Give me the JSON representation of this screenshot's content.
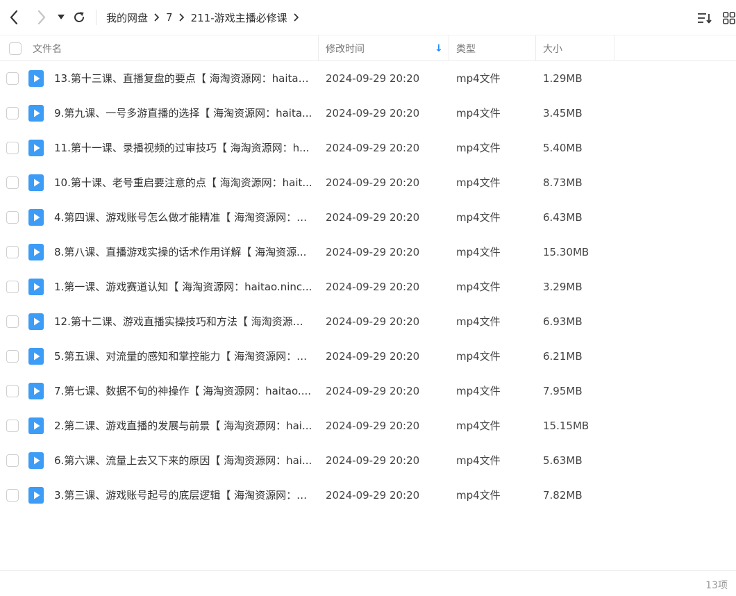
{
  "nav": {
    "icons": [
      "chevron-left-icon",
      "chevron-right-icon",
      "caret-down-icon",
      "refresh-icon"
    ]
  },
  "breadcrumb": {
    "items": [
      "我的网盘",
      "7",
      "211-游戏主播必修课"
    ]
  },
  "toolbar": {
    "icons": [
      "sort-icon",
      "grid-view-icon"
    ]
  },
  "table": {
    "columns": {
      "name": "文件名",
      "modified": "修改时间",
      "type": "类型",
      "size": "大小"
    },
    "sort_indicator": "↓",
    "rows": [
      {
        "name": "13.第十三课、直播复盘的要点【 海淘资源网：haitao....",
        "modified": "2024-09-29 20:20",
        "type": "mp4文件",
        "size": "1.29MB"
      },
      {
        "name": "9.第九课、一号多游直播的选择【 海淘资源网：haita...",
        "modified": "2024-09-29 20:20",
        "type": "mp4文件",
        "size": "3.45MB"
      },
      {
        "name": "11.第十一课、录播视频的过审技巧【 海淘资源网：h...",
        "modified": "2024-09-29 20:20",
        "type": "mp4文件",
        "size": "5.40MB"
      },
      {
        "name": "10.第十课、老号重启要注意的点【 海淘资源网：hait...",
        "modified": "2024-09-29 20:20",
        "type": "mp4文件",
        "size": "8.73MB"
      },
      {
        "name": "4.第四课、游戏账号怎么做才能精准【 海淘资源网：h...",
        "modified": "2024-09-29 20:20",
        "type": "mp4文件",
        "size": "6.43MB"
      },
      {
        "name": "8.第八课、直播游戏实操的话术作用详解【 海淘资源...",
        "modified": "2024-09-29 20:20",
        "type": "mp4文件",
        "size": "15.30MB"
      },
      {
        "name": "1.第一课、游戏赛道认知【 海淘资源网：haitao.ninc...",
        "modified": "2024-09-29 20:20",
        "type": "mp4文件",
        "size": "3.29MB"
      },
      {
        "name": "12.第十二课、游戏直播实操技巧和方法【 海淘资源网...",
        "modified": "2024-09-29 20:20",
        "type": "mp4文件",
        "size": "6.93MB"
      },
      {
        "name": "5.第五课、对流量的感知和掌控能力【 海淘资源网：h...",
        "modified": "2024-09-29 20:20",
        "type": "mp4文件",
        "size": "6.21MB"
      },
      {
        "name": "7.第七课、数据不旬的神操作【 海淘资源网：haitao....",
        "modified": "2024-09-29 20:20",
        "type": "mp4文件",
        "size": "7.95MB"
      },
      {
        "name": "2.第二课、游戏直播的发展与前景【 海淘资源网：hai...",
        "modified": "2024-09-29 20:20",
        "type": "mp4文件",
        "size": "15.15MB"
      },
      {
        "name": "6.第六课、流量上去又下来的原因【 海淘资源网：hai...",
        "modified": "2024-09-29 20:20",
        "type": "mp4文件",
        "size": "5.63MB"
      },
      {
        "name": "3.第三课、游戏账号起号的底层逻辑【 海淘资源网：h...",
        "modified": "2024-09-29 20:20",
        "type": "mp4文件",
        "size": "7.82MB"
      }
    ]
  },
  "footer": {
    "count": "13项"
  },
  "colors": {
    "accent": "#1a8cff",
    "file_icon": "#3d9cf5"
  }
}
